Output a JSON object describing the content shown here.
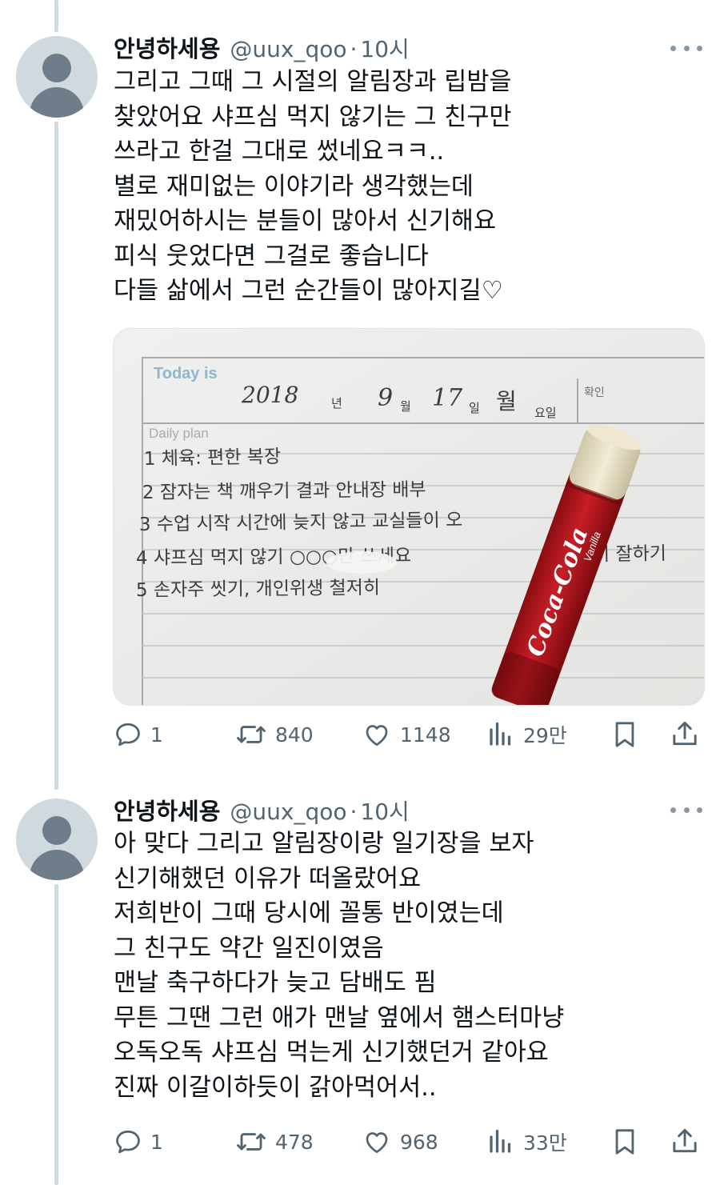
{
  "tweets": [
    {
      "author": {
        "name": "안녕하세용",
        "handle": "@uux_qoo"
      },
      "separator": "·",
      "time": "10시",
      "lines": [
        "그리고 그때 그 시절의 알림장과 립밤을",
        "찾았어요 샤프심 먹지 않기는 그 친구만",
        "쓰라고 한걸 그대로 썼네요ㅋㅋ..",
        "별로 재미없는 이야기라 생각했는데",
        "재밌어하시는 분들이 많아서 신기해요",
        "피식 웃었다면 그걸로 좋습니다",
        "다들 삶에서 그런 순간들이 많아지길♡"
      ],
      "media": {
        "planner": {
          "today_label": "Today is",
          "year": "2018",
          "year_unit": "년",
          "month": "9",
          "month_unit": "월",
          "day": "17",
          "day_unit": "일",
          "weekday": "월",
          "weekday_unit": "요일",
          "confirm_label": "확인",
          "daily_plan_label": "Daily plan",
          "items": [
            "1 체육: 편한 복장",
            "2 잠자는 책 깨우기 결과 안내장 배부",
            "3 수업 시작 시간에 늦지 않고 교실들이 오",
            "4 샤프심 먹지 않기 ○○○만 쓰세요",
            "5 손자주 씻기, 개인위생 철저히"
          ],
          "item_tail": "준비 잘하기"
        },
        "lipbalm": {
          "brand": "Coca-Cola",
          "flavor": "Vanilla"
        }
      },
      "stats": {
        "replies": "1",
        "retweets": "840",
        "likes": "1148",
        "views": "29만"
      }
    },
    {
      "author": {
        "name": "안녕하세용",
        "handle": "@uux_qoo"
      },
      "separator": "·",
      "time": "10시",
      "lines": [
        "아 맞다 그리고 알림장이랑 일기장을 보자",
        "신기해했던 이유가 떠올랐어요",
        "저희반이 그때 당시에 꼴통 반이였는데",
        "그 친구도 약간 일진이였음",
        "맨날 축구하다가 늦고 담배도 핌",
        "무튼 그땐 그런 애가 맨날 옆에서 햄스터마냥",
        "오독오독 샤프심 먹는게 신기했던거 같아요",
        "진짜 이갈이하듯이 갉아먹어서.."
      ],
      "stats": {
        "replies": "1",
        "retweets": "478",
        "likes": "968",
        "views": "33만"
      }
    }
  ],
  "colors": {
    "text": "#0f1419",
    "secondary": "#536471",
    "thread_line": "#cfd9de",
    "lipbalm_red": "#b5121b"
  }
}
